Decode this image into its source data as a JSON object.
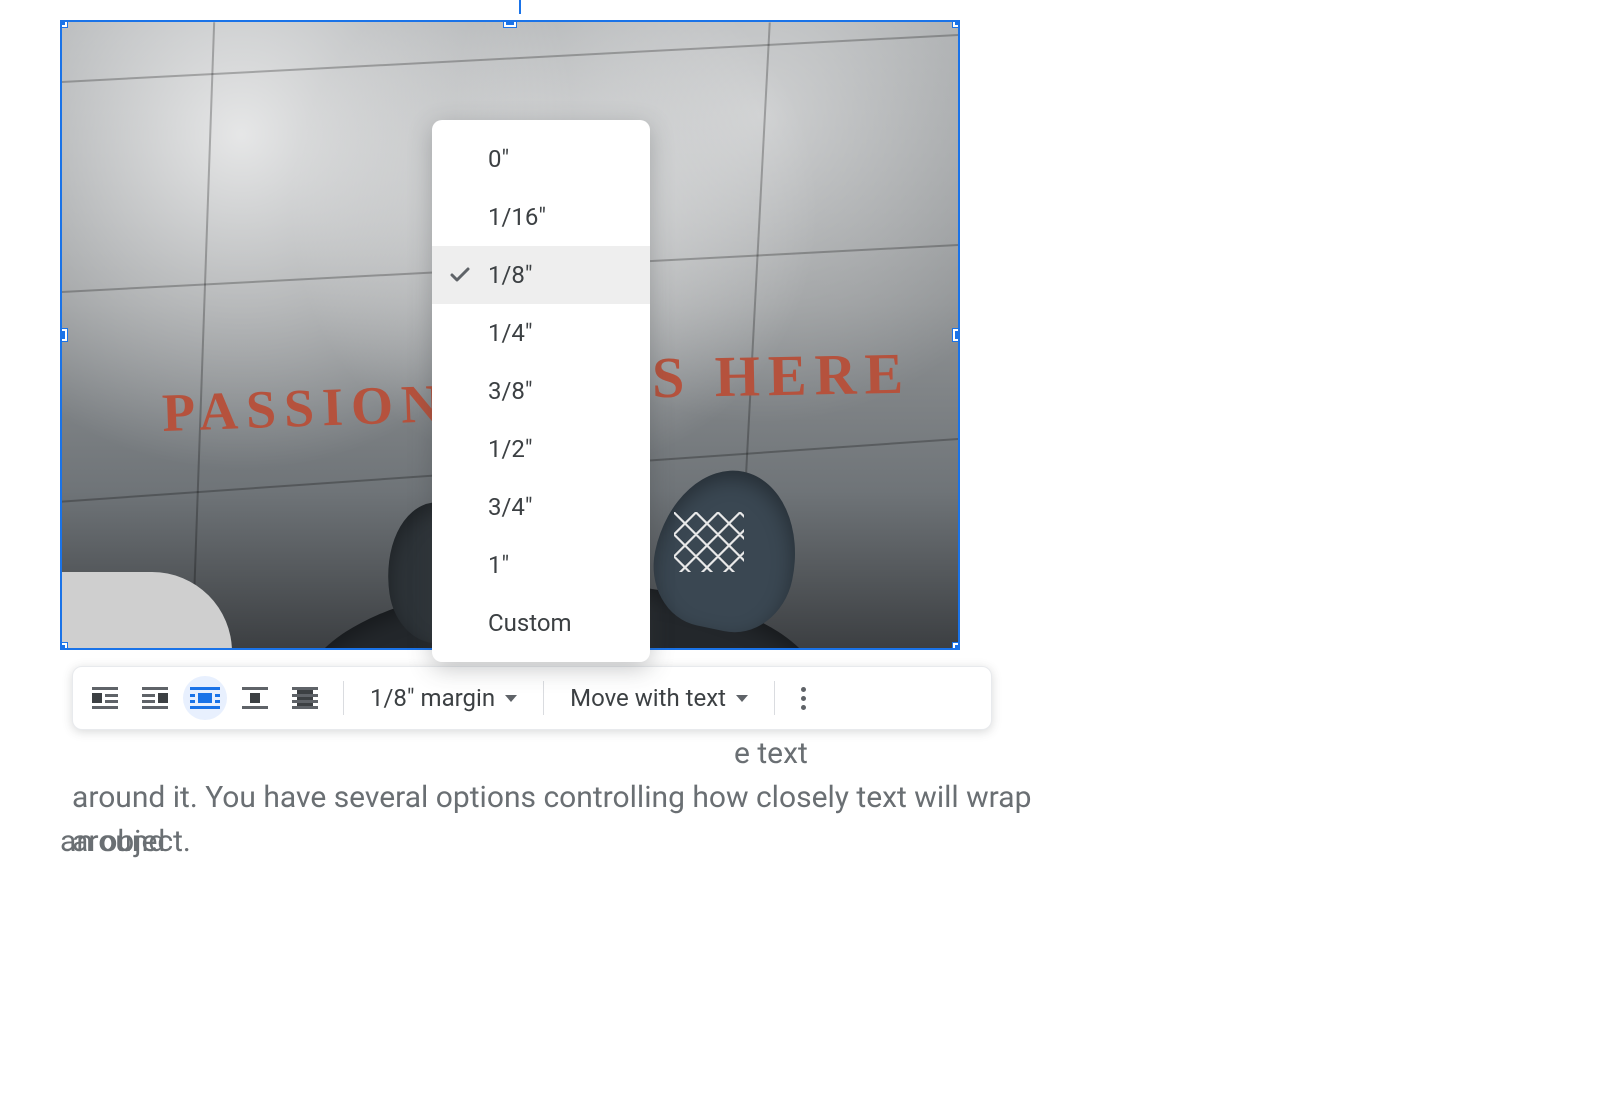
{
  "image": {
    "text_left": "PASSION",
    "text_right": "S HERE"
  },
  "margin_menu": {
    "options": [
      "0\"",
      "1/16\"",
      "1/8\"",
      "1/4\"",
      "3/8\"",
      "1/2\"",
      "3/4\"",
      "1\"",
      "Custom"
    ],
    "selected": "1/8\""
  },
  "toolbar": {
    "wrap_modes": [
      "inline",
      "wrap-left",
      "wrap-around",
      "wrap-right",
      "break"
    ],
    "active_wrap_mode": "wrap-around",
    "margin_label": "1/8\" margin",
    "position_label": "Move with text"
  },
  "doc_text": {
    "frag_right": "e text",
    "line2": "around it. You have several options controlling how closely text will wrap around",
    "line3": "an object."
  }
}
